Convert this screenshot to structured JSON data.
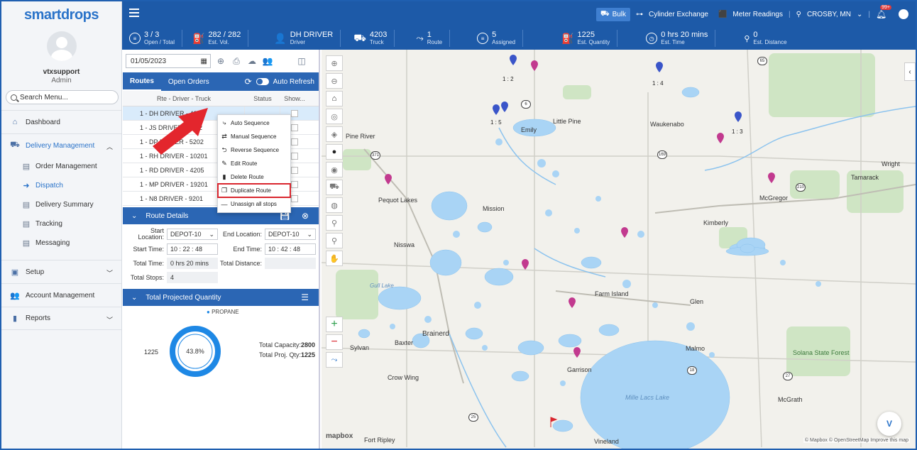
{
  "app": {
    "logo_text": "smartdrops",
    "colors": {
      "primary": "#1d5aa8",
      "accent": "#2a73c9",
      "highlight": "#d9262e",
      "pin_blue": "#3a55c9",
      "pin_pink": "#c23a8f",
      "water": "#a9d4f5"
    }
  },
  "sidebar": {
    "user_name": "vtxsupport",
    "user_role": "Admin",
    "search_placeholder": "Search Menu...",
    "items": [
      {
        "label": "Dashboard",
        "icon": "home-icon"
      },
      {
        "label": "Delivery Management",
        "icon": "delivery-icon"
      },
      {
        "label": "Setup",
        "icon": "setup-icon"
      },
      {
        "label": "Account Management",
        "icon": "users-icon"
      },
      {
        "label": "Reports",
        "icon": "report-icon"
      }
    ],
    "sub_items": [
      {
        "label": "Order Management",
        "icon": "order-icon"
      },
      {
        "label": "Dispatch",
        "icon": "dispatch-icon"
      },
      {
        "label": "Delivery Summary",
        "icon": "summary-icon"
      },
      {
        "label": "Tracking",
        "icon": "tracking-icon"
      },
      {
        "label": "Messaging",
        "icon": "messaging-icon"
      }
    ]
  },
  "topbar": {
    "bulk": "Bulk",
    "cylinder": "Cylinder Exchange",
    "meter": "Meter Readings",
    "location": "CROSBY, MN",
    "bell_badge": "99+"
  },
  "stats": [
    {
      "value": "3 / 3",
      "label": "Open / Total"
    },
    {
      "value": "282 / 282",
      "label": "Est. Vol."
    },
    {
      "value": "DH DRIVER",
      "label": "Driver"
    },
    {
      "value": "4203",
      "label": "Truck"
    },
    {
      "value": "1",
      "label": "Route"
    },
    {
      "value": "5",
      "label": "Assigned"
    },
    {
      "value": "1225",
      "label": "Est. Quantity"
    },
    {
      "value": "0 hrs 20 mins",
      "label": "Est. Time"
    },
    {
      "value": "0",
      "label": "Est. Distance"
    }
  ],
  "panel": {
    "date": "01/05/2023",
    "tabs": {
      "routes": "Routes",
      "open_orders": "Open Orders",
      "auto_refresh": "Auto Refresh"
    },
    "columns": {
      "route": "Rte - Driver - Truck",
      "status": "Status",
      "show": "Show..."
    },
    "routes": [
      "1 - DH DRIVER - 4203",
      "1 - JS DRIVER - 5202",
      "1 - DP DRIVER - 5202",
      "1 - RH DRIVER - 10201",
      "1 - RD DRIVER - 4205",
      "1 - MP DRIVER - 19201",
      "1 - N8 DRIVER - 9201"
    ],
    "route_details": {
      "title": "Route Details",
      "start_location_label": "Start Location:",
      "start_location": "DEPOT-10",
      "end_location_label": "End Location:",
      "end_location": "DEPOT-10",
      "start_time_label": "Start Time:",
      "start_time": "10 : 22 : 48",
      "end_time_label": "End Time:",
      "end_time": "10 : 42 : 48",
      "total_time_label": "Total Time:",
      "total_time": "0 hrs 20 mins",
      "total_distance_label": "Total Distance:",
      "total_distance": "",
      "total_stops_label": "Total Stops:",
      "total_stops": "4"
    },
    "projected": {
      "title": "Total Projected Quantity",
      "legend": "PROPANE",
      "left_value": "1225",
      "percent": "43.8%",
      "percent_fraction": 0.438,
      "capacity_label": "Total Capacity:",
      "capacity": "2800",
      "proj_label": "Total Proj. Qty:",
      "proj": "1225"
    }
  },
  "context_menu": [
    {
      "label": "Auto Sequence",
      "icon": "auto-sequence-icon"
    },
    {
      "label": "Manual Sequence",
      "icon": "manual-sequence-icon"
    },
    {
      "label": "Reverse Sequence",
      "icon": "reverse-icon"
    },
    {
      "label": "Edit Route",
      "icon": "edit-icon"
    },
    {
      "label": "Delete Route",
      "icon": "trash-icon"
    },
    {
      "label": "Duplicate Route",
      "icon": "copy-icon"
    },
    {
      "label": "Unassign all stops",
      "icon": "minus-icon"
    }
  ],
  "map": {
    "towns": [
      "Pine River",
      "Emily",
      "Little Pine",
      "Waukenabo",
      "Wright",
      "Tamarack",
      "McGregor",
      "Pequot Lakes",
      "Mission",
      "Kimberly",
      "Nisswa",
      "Farm Island",
      "Glen",
      "Brainerd",
      "Baxter",
      "Sylvan",
      "Garrison",
      "Malmo",
      "Crow Wing",
      "Mille Lacs Lake",
      "McGrath",
      "Solana State Forest",
      "Fort Ripley",
      "Vineland",
      "Gull Lake"
    ],
    "route_labels": [
      "1 : 2",
      "1 : 4",
      "1 : 5",
      "1 : 3"
    ],
    "road_numbers": [
      "65",
      "6",
      "371",
      "169",
      "210",
      "18",
      "27",
      "25"
    ],
    "attribution": "© Mapbox © OpenStreetMap Improve this map",
    "mapbox": "mapbox"
  }
}
